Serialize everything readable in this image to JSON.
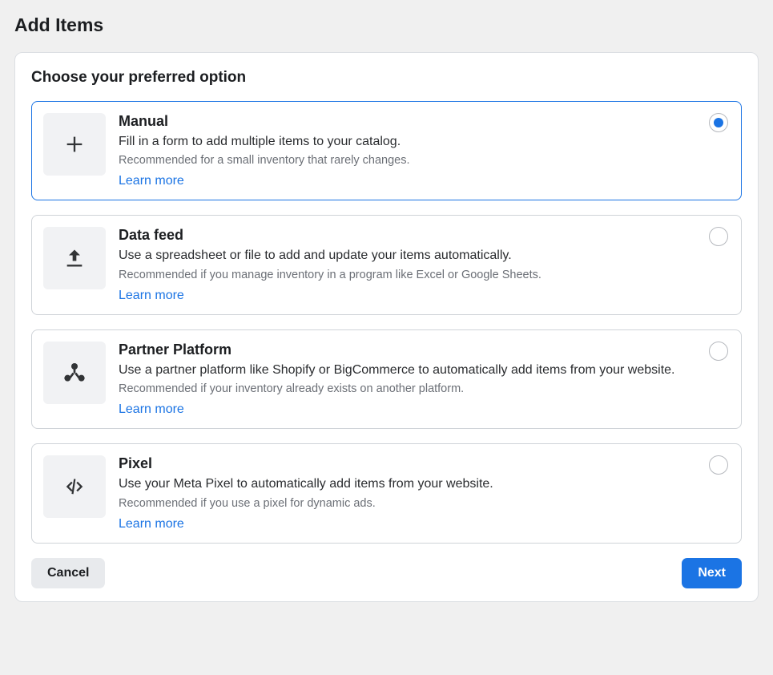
{
  "page_title": "Add Items",
  "subtitle": "Choose your preferred option",
  "learn_more_label": "Learn more",
  "options": [
    {
      "id": "manual",
      "title": "Manual",
      "desc": "Fill in a form to add multiple items to your catalog.",
      "rec": "Recommended for a small inventory that rarely changes.",
      "selected": true,
      "icon": "plus-icon"
    },
    {
      "id": "data-feed",
      "title": "Data feed",
      "desc": "Use a spreadsheet or file to add and update your items automatically.",
      "rec": "Recommended if you manage inventory in a program like Excel or Google Sheets.",
      "selected": false,
      "icon": "upload-icon"
    },
    {
      "id": "partner-platform",
      "title": "Partner Platform",
      "desc": "Use a partner platform like Shopify or BigCommerce to automatically add items from your website.",
      "rec": "Recommended if your inventory already exists on another platform.",
      "selected": false,
      "icon": "nodes-icon"
    },
    {
      "id": "pixel",
      "title": "Pixel",
      "desc": "Use your Meta Pixel to automatically add items from your website.",
      "rec": "Recommended if you use a pixel for dynamic ads.",
      "selected": false,
      "icon": "code-icon"
    }
  ],
  "footer": {
    "cancel_label": "Cancel",
    "next_label": "Next"
  }
}
